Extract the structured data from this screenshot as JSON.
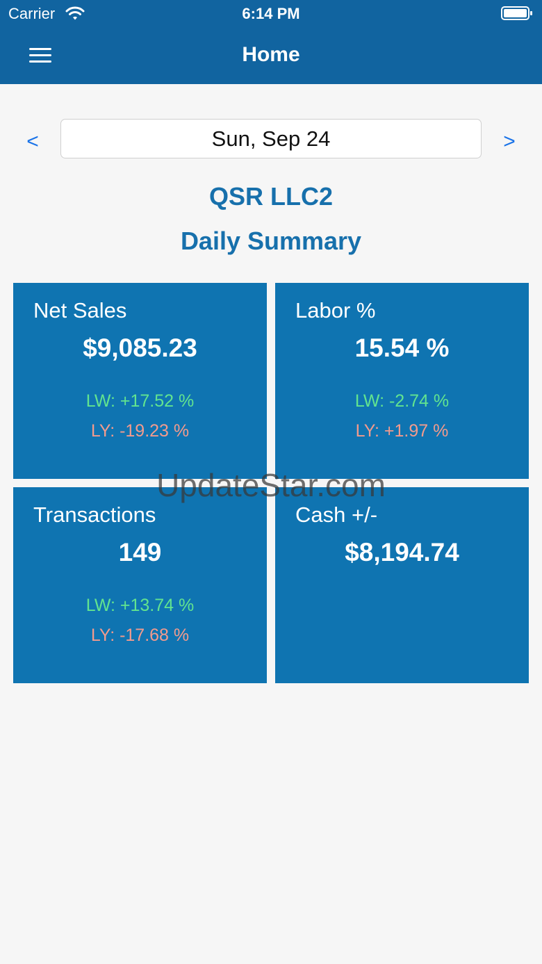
{
  "status_bar": {
    "carrier": "Carrier",
    "time": "6:14 PM"
  },
  "navbar": {
    "title": "Home",
    "menu_icon": "hamburger-menu-icon",
    "background_color": "#1164a0"
  },
  "date_picker": {
    "prev_label": "<",
    "date": "Sun, Sep 24",
    "next_label": ">"
  },
  "company_name": "QSR LLC2",
  "summary_title": "Daily Summary",
  "cards": [
    {
      "label": "Net Sales",
      "value": "$9,085.23",
      "lw": "LW: +17.52 %",
      "ly": "LY: -19.23 %"
    },
    {
      "label": "Labor %",
      "value": "15.54 %",
      "lw": "LW: -2.74 %",
      "ly": "LY: +1.97 %"
    },
    {
      "label": "Transactions",
      "value": "149",
      "lw": "LW: +13.74 %",
      "ly": "LY: -17.68 %"
    },
    {
      "label": "Cash +/-",
      "value": "$8,194.74"
    }
  ],
  "colors": {
    "accent": "#1770ac",
    "card": "#0f74b1",
    "positive": "#62e48f",
    "negative": "#f39b8d"
  },
  "watermark": "UpdateStar.com"
}
